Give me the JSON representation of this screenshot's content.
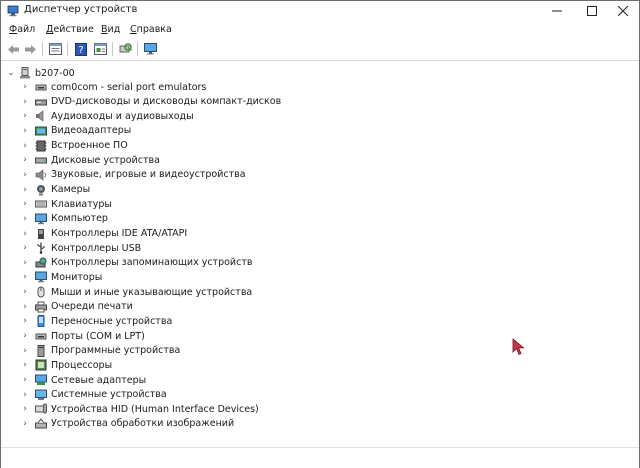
{
  "window": {
    "title": "Диспетчер устройств"
  },
  "menu": [
    {
      "underlined": "Ф",
      "rest": "айл"
    },
    {
      "underlined": "Д",
      "rest": "ействие"
    },
    {
      "underlined": "В",
      "rest": "ид"
    },
    {
      "underlined": "С",
      "rest": "правка"
    }
  ],
  "toolbar": [
    "back-arrow-icon",
    "forward-arrow-icon",
    "properties-icon",
    "help-icon",
    "update-driver-icon",
    "scan-hardware-icon",
    "monitor-icon"
  ],
  "tree": {
    "root": "b207-00",
    "items": [
      {
        "label": "com0com - serial port emulators",
        "icon": "port-icon"
      },
      {
        "label": "DVD-дисководы и дисководы компакт-дисков",
        "icon": "dvd-drive-icon"
      },
      {
        "label": "Аудиовходы и аудиовыходы",
        "icon": "speaker-icon"
      },
      {
        "label": "Видеоадаптеры",
        "icon": "display-adapter-icon"
      },
      {
        "label": "Встроенное ПО",
        "icon": "firmware-icon"
      },
      {
        "label": "Дисковые устройства",
        "icon": "disk-drive-icon"
      },
      {
        "label": "Звуковые, игровые и видеоустройства",
        "icon": "sound-icon"
      },
      {
        "label": "Камеры",
        "icon": "camera-icon"
      },
      {
        "label": "Клавиатуры",
        "icon": "keyboard-icon"
      },
      {
        "label": "Компьютер",
        "icon": "computer-icon"
      },
      {
        "label": "Контроллеры IDE ATA/ATAPI",
        "icon": "ide-controller-icon"
      },
      {
        "label": "Контроллеры USB",
        "icon": "usb-icon"
      },
      {
        "label": "Контроллеры запоминающих устройств",
        "icon": "storage-controller-icon"
      },
      {
        "label": "Мониторы",
        "icon": "monitor-icon"
      },
      {
        "label": "Мыши и иные указывающие устройства",
        "icon": "mouse-icon"
      },
      {
        "label": "Очереди печати",
        "icon": "printer-icon"
      },
      {
        "label": "Переносные устройства",
        "icon": "portable-device-icon"
      },
      {
        "label": "Порты (COM и LPT)",
        "icon": "port-icon"
      },
      {
        "label": "Программные устройства",
        "icon": "software-device-icon"
      },
      {
        "label": "Процессоры",
        "icon": "processor-icon"
      },
      {
        "label": "Сетевые адаптеры",
        "icon": "network-adapter-icon"
      },
      {
        "label": "Системные устройства",
        "icon": "system-device-icon"
      },
      {
        "label": "Устройства HID (Human Interface Devices)",
        "icon": "hid-icon"
      },
      {
        "label": "Устройства обработки изображений",
        "icon": "imaging-device-icon"
      }
    ]
  }
}
